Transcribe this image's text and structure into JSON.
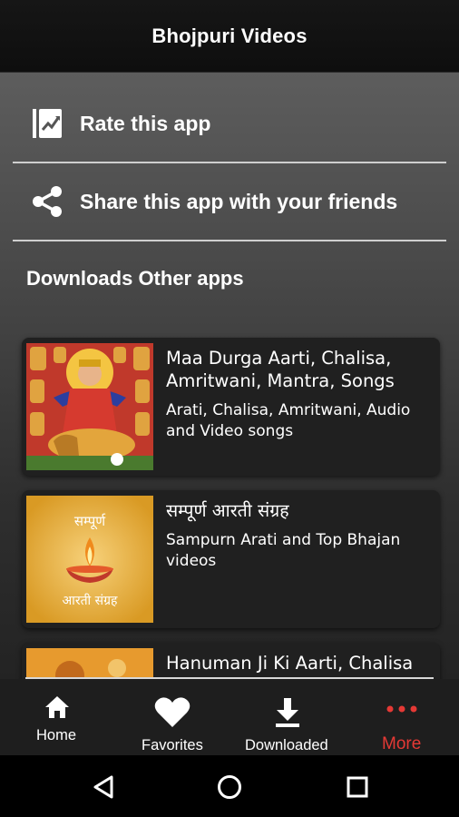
{
  "app": {
    "title": "Bhojpuri Videos"
  },
  "menu": [
    {
      "label": "Rate this app",
      "icon": "rate-app-icon"
    },
    {
      "label": "Share this app with your friends",
      "icon": "share-icon"
    }
  ],
  "other_apps": {
    "title": "Downloads Other apps",
    "items": [
      {
        "name": "Maa Durga Aarti, Chalisa, Amritwani, Mantra, Songs",
        "description": "Arati, Chalisa, Amritwani, Audio and Video songs",
        "thumb": "durga-image"
      },
      {
        "name": "सम्पूर्ण आरती संग्रह",
        "description": "Sampurn Arati and Top Bhajan videos",
        "thumb": "arati-sangrah-image",
        "thumb_text_top": "सम्पूर्ण",
        "thumb_text_bottom": "आरती संग्रह"
      },
      {
        "name": "Hanuman Ji Ki Aarti, Chalisa",
        "thumb": "hanuman-image"
      }
    ]
  },
  "bottom_nav": [
    {
      "label": "Home",
      "icon": "home-icon"
    },
    {
      "label": "Favorites",
      "icon": "heart-icon"
    },
    {
      "label": "Downloaded",
      "icon": "download-icon"
    },
    {
      "label": "More",
      "icon": "more-dots-icon",
      "active": true
    }
  ],
  "colors": {
    "accent": "#e53935",
    "card_bg": "#202020",
    "topbar_bg": "#121212"
  }
}
